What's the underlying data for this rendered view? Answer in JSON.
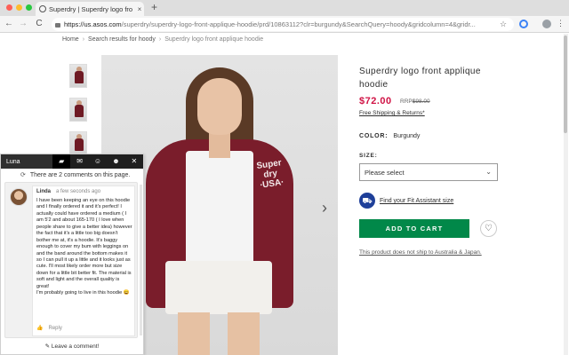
{
  "browser": {
    "tab_title": "Superdry | Superdry logo fro",
    "tab_close": "×",
    "new_tab": "+",
    "url_host": "https://us.asos.com",
    "url_path": "/superdry/superdry-logo-front-applique-hoodie/prd/10863112?clr=burgundy&SearchQuery=hoody&gridcolumn=4&gridr...",
    "back": "←",
    "forward": "→",
    "reload": "C",
    "star": "☆",
    "menu": "⋮"
  },
  "breadcrumb": {
    "home": "Home",
    "results": "Search results for hoody",
    "current": "Superdry logo front applique hoodie",
    "separator": "›"
  },
  "product": {
    "image_logo": "Super\ndry\n∙USA∙",
    "next_arrow": "›",
    "title": "Superdry logo front applique hoodie",
    "price": "$72.00",
    "rrp_label": "RRP",
    "rrp_value": "$98.00",
    "shipping_link": "Free Shipping & Returns*",
    "colour_label": "COLOR:",
    "colour_value": "Burgundy",
    "size_label": "SIZE:",
    "size_placeholder": "Please select",
    "fit_link": "Find your Fit Assistant size",
    "add_to_cart": "ADD TO CART",
    "save_icon": "♡",
    "ship_note": "This product does not ship to Australia & Japan."
  },
  "overlay": {
    "user": "Luna",
    "icons": [
      "▰",
      "✉",
      "☺",
      "☻",
      "✕"
    ],
    "refresh": "⟳",
    "count_text": "There are 2 comments on this page.",
    "comment": {
      "author": "Linda",
      "time": "a few seconds ago",
      "text": "I have been keeping an eye on this hoodie and I finally ordered it and it's perfect! I actually could have ordered a medium ( I am 5'2 and about 165-170 ( I love when people share to give a better idea) however the fact that it's a little too big doesn't bother me at, it's a hoodie. It's baggy enough to cover my bum with leggings on and the band around the bottom makes it so I can pull it up a little and it looks just as cute. I'll most likely order more but size down for a little bit better fit. The material is soft and light and the overall quality is great!\nI'm probably going to live in this hoodie 😄",
      "like": "👍",
      "reply": "Reply"
    },
    "leave_comment": "✎  Leave a comment!"
  },
  "colors": {
    "price": "#d01345",
    "add_to_cart": "#018849",
    "hoodie": "#7a1d2b",
    "fit_icon": "#1e3f99"
  }
}
